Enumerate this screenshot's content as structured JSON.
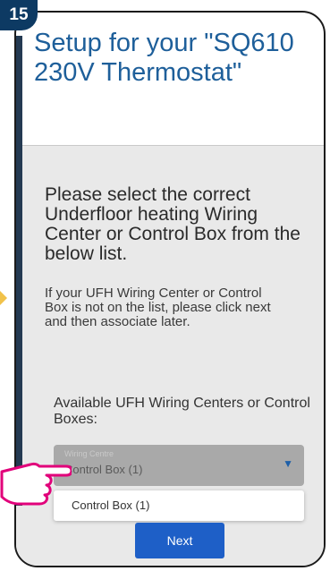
{
  "step": "15",
  "header": {
    "title": "Setup for your \"SQ610 230V Thermostat\""
  },
  "content": {
    "heading": "Please select the correct Underfloor heating Wiring Center or Control Box from the below list.",
    "subtext": "If your UFH Wiring Center or Control Box is not on the list, please click next and then associate later.",
    "available_label": "Available UFH Wiring Centers or Control Boxes:"
  },
  "select": {
    "placeholder": "Wiring Centre",
    "value": "Control Box (1)",
    "options": [
      "Control Box (1)"
    ]
  },
  "buttons": {
    "next": "Next"
  },
  "colors": {
    "title": "#1e5f9a",
    "button": "#1e5fc7",
    "badge": "#0d3a63",
    "hand": "#e1007a"
  }
}
